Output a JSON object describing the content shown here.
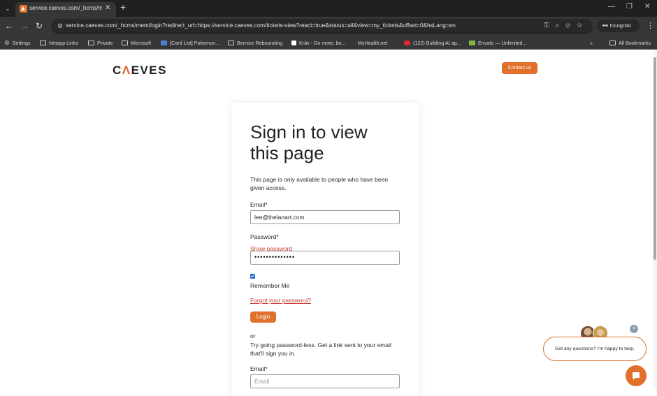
{
  "browser": {
    "tab_title": "service.caeves.com/_hcms/mem",
    "url": "service.caeves.com/_hcms/mem/login?redirect_url=https://service.caeves.com/tickets-view?react=true&status=all&view=my_tickets&offset=0&hsLang=en",
    "profile_label": "Incognito",
    "bookmarks": [
      {
        "label": "Settings",
        "icon": "gear-icon"
      },
      {
        "label": "Netapp Links",
        "icon": "folder-icon"
      },
      {
        "label": "Private",
        "icon": "folder-icon"
      },
      {
        "label": "Microsoft",
        "icon": "folder-icon"
      },
      {
        "label": "[Card List] Pokemon...",
        "icon": "pokemon-favicon"
      },
      {
        "label": "Bernice Rebounding",
        "icon": "folder-icon"
      },
      {
        "label": "Kräv - Do more, be...",
        "icon": "krav-favicon"
      },
      {
        "label": "MyHealth.net",
        "icon": "none"
      },
      {
        "label": "(122) Building AI ap...",
        "icon": "youtube-icon"
      },
      {
        "label": "Envato — Unlimited...",
        "icon": "envato-icon"
      }
    ],
    "all_bookmarks_label": "All Bookmarks",
    "colors": {
      "chrome_dark": "#1f2020",
      "toolbar": "#353637"
    }
  },
  "header": {
    "logo_text_1": "C",
    "logo_text_accent": "Λ",
    "logo_text_2": "EVES",
    "contact_button": "Contact us"
  },
  "login": {
    "title": "Sign in to view this page",
    "description": "This page is only available to people who have been given access.",
    "email_label": "Email*",
    "email_value": "lee@thelanart.com",
    "password_label": "Password*",
    "show_password": "Show password",
    "password_value": "••••••••••••••",
    "remember_checked": true,
    "remember_label": "Remember Me",
    "forgot_link": "Forgot your password?",
    "login_button": "Login",
    "or_text": "or",
    "passwordless_text": "Try going password-less. Get a link sent to your email that'll sign you in.",
    "email2_label": "Email*",
    "email2_placeholder": "Email"
  },
  "chat": {
    "message": "Got any questions? I'm happy to help.",
    "close_symbol": "×"
  },
  "colors": {
    "accent": "#e0702c",
    "link": "#c9392d"
  }
}
